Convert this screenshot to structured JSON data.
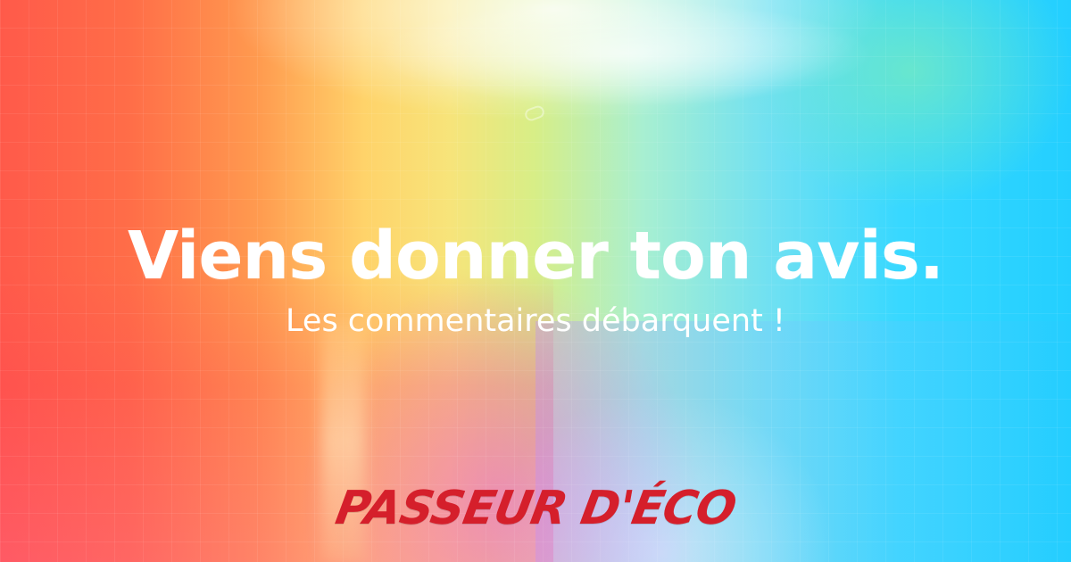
{
  "headline": "Viens donner ton avis.",
  "subheadline": "Les commentaires débarquent !",
  "brand": {
    "name": "PASSEUR D'ÉCO"
  },
  "colors": {
    "text_primary": "#ffffff",
    "brand_red": "#d51f2b"
  }
}
